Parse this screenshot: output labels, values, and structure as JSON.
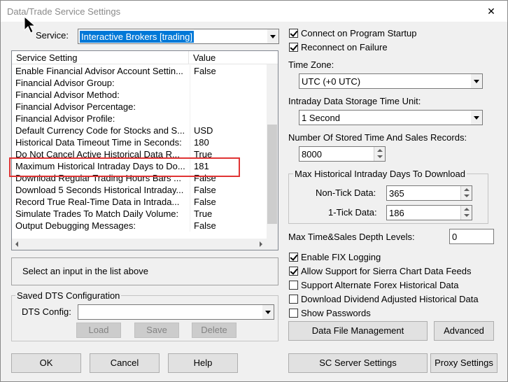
{
  "window": {
    "title": "Data/Trade Service Settings",
    "close_glyph": "✕"
  },
  "service": {
    "label": "Service:",
    "value": "Interactive Brokers    [trading]"
  },
  "table": {
    "headers": [
      "Service Setting",
      "Value"
    ],
    "rows": [
      {
        "setting": "Enable Financial Advisor Account Settin...",
        "value": "False"
      },
      {
        "setting": "Financial Advisor Group:",
        "value": ""
      },
      {
        "setting": "Financial Advisor Method:",
        "value": ""
      },
      {
        "setting": "Financial Advisor Percentage:",
        "value": ""
      },
      {
        "setting": "Financial Advisor Profile:",
        "value": ""
      },
      {
        "setting": "Default Currency Code for Stocks and S...",
        "value": "USD"
      },
      {
        "setting": "Historical Data Timeout Time in Seconds:",
        "value": "180"
      },
      {
        "setting": "Do Not Cancel Active Historical Data R...",
        "value": "True"
      },
      {
        "setting": "Maximum Historical Intraday Days to Do...",
        "value": "181"
      },
      {
        "setting": "Download Regular Trading Hours Bars ...",
        "value": "False"
      },
      {
        "setting": "Download 5 Seconds Historical Intraday...",
        "value": "False"
      },
      {
        "setting": "Record True Real-Time Data in Intrada...",
        "value": "False"
      },
      {
        "setting": "Simulate Trades To Match Daily Volume:",
        "value": "True"
      },
      {
        "setting": "Output Debugging Messages:",
        "value": "False"
      }
    ]
  },
  "help_text": "Select an input in the list above",
  "saved_dts": {
    "group_title": "Saved DTS Configuration",
    "config_label": "DTS Config:",
    "config_value": "",
    "load": "Load",
    "save": "Save",
    "delete": "Delete"
  },
  "bottom_left": {
    "ok": "OK",
    "cancel": "Cancel",
    "help": "Help"
  },
  "right": {
    "connect_startup": "Connect on Program Startup",
    "reconnect": "Reconnect on Failure",
    "timezone_label": "Time Zone:",
    "timezone_value": "UTC (+0 UTC)",
    "storage_label": "Intraday Data Storage Time Unit:",
    "storage_value": "1 Second",
    "records_label": "Number Of Stored Time And Sales Records:",
    "records_value": "8000",
    "max_days_title": "Max Historical Intraday Days To Download",
    "nontick_label": "Non-Tick Data:",
    "nontick_value": "365",
    "onetick_label": "1-Tick Data:",
    "onetick_value": "186",
    "depth_label": "Max Time&Sales Depth Levels:",
    "depth_value": "0",
    "fix_logging": "Enable FIX Logging",
    "allow_sierra": "Allow Support for Sierra Chart Data Feeds",
    "forex": "Support Alternate Forex Historical Data",
    "dividend": "Download Dividend Adjusted Historical Data",
    "show_passwords": "Show Passwords",
    "data_file_mgmt": "Data File Management",
    "advanced": "Advanced",
    "sc_server": "SC Server Settings",
    "proxy": "Proxy Settings"
  },
  "checks": {
    "connect_startup": true,
    "reconnect": true,
    "fix_logging": true,
    "allow_sierra": true,
    "forex": false,
    "dividend": false,
    "show_passwords": false
  }
}
